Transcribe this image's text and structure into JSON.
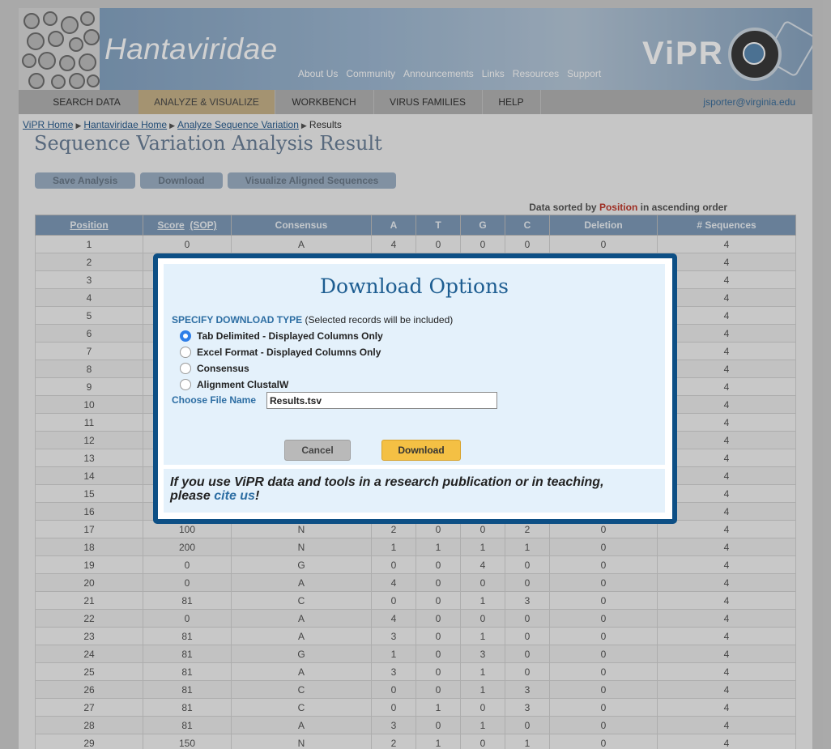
{
  "header": {
    "title": "Hantaviridae",
    "logo_text": "ViPR",
    "nav": [
      "About Us",
      "Community",
      "Announcements",
      "Links",
      "Resources",
      "Support"
    ]
  },
  "menu": {
    "items": [
      "SEARCH DATA",
      "ANALYZE & VISUALIZE",
      "WORKBENCH",
      "VIRUS FAMILIES",
      "HELP"
    ],
    "active": "ANALYZE & VISUALIZE",
    "user": "jsporter@virginia.edu"
  },
  "breadcrumb": {
    "links": [
      "ViPR Home",
      "Hantaviridae Home",
      "Analyze Sequence Variation"
    ],
    "current": "Results"
  },
  "page_title": "Sequence Variation Analysis Result",
  "action_buttons": [
    "Save Analysis",
    "Download",
    "Visualize Aligned Sequences"
  ],
  "sort_note": {
    "prefix": "Data sorted by",
    "field": "Position",
    "suffix": "in ascending order"
  },
  "table": {
    "columns": [
      "Position",
      "Score",
      "(SOP)",
      "Consensus",
      "A",
      "T",
      "G",
      "C",
      "Deletion",
      "# Sequences"
    ],
    "rows": [
      [
        "1",
        "0",
        "A",
        "4",
        "0",
        "0",
        "0",
        "0",
        "4"
      ],
      [
        "2",
        "",
        "",
        "",
        "",
        "",
        "",
        "",
        "4"
      ],
      [
        "3",
        "",
        "",
        "",
        "",
        "",
        "",
        "",
        "4"
      ],
      [
        "4",
        "",
        "",
        "",
        "",
        "",
        "",
        "",
        "4"
      ],
      [
        "5",
        "",
        "",
        "",
        "",
        "",
        "",
        "",
        "4"
      ],
      [
        "6",
        "",
        "",
        "",
        "",
        "",
        "",
        "",
        "4"
      ],
      [
        "7",
        "",
        "",
        "",
        "",
        "",
        "",
        "",
        "4"
      ],
      [
        "8",
        "",
        "",
        "",
        "",
        "",
        "",
        "",
        "4"
      ],
      [
        "9",
        "",
        "",
        "",
        "",
        "",
        "",
        "",
        "4"
      ],
      [
        "10",
        "",
        "",
        "",
        "",
        "",
        "",
        "",
        "4"
      ],
      [
        "11",
        "",
        "",
        "",
        "",
        "",
        "",
        "",
        "4"
      ],
      [
        "12",
        "",
        "",
        "",
        "",
        "",
        "",
        "",
        "4"
      ],
      [
        "13",
        "",
        "",
        "",
        "",
        "",
        "",
        "",
        "4"
      ],
      [
        "14",
        "",
        "",
        "",
        "",
        "",
        "",
        "",
        "4"
      ],
      [
        "15",
        "",
        "",
        "",
        "",
        "",
        "",
        "",
        "4"
      ],
      [
        "16",
        "",
        "",
        "",
        "",
        "",
        "",
        "",
        "4"
      ],
      [
        "17",
        "100",
        "N",
        "2",
        "0",
        "0",
        "2",
        "0",
        "4"
      ],
      [
        "18",
        "200",
        "N",
        "1",
        "1",
        "1",
        "1",
        "0",
        "4"
      ],
      [
        "19",
        "0",
        "G",
        "0",
        "0",
        "4",
        "0",
        "0",
        "4"
      ],
      [
        "20",
        "0",
        "A",
        "4",
        "0",
        "0",
        "0",
        "0",
        "4"
      ],
      [
        "21",
        "81",
        "C",
        "0",
        "0",
        "1",
        "3",
        "0",
        "4"
      ],
      [
        "22",
        "0",
        "A",
        "4",
        "0",
        "0",
        "0",
        "0",
        "4"
      ],
      [
        "23",
        "81",
        "A",
        "3",
        "0",
        "1",
        "0",
        "0",
        "4"
      ],
      [
        "24",
        "81",
        "G",
        "1",
        "0",
        "3",
        "0",
        "0",
        "4"
      ],
      [
        "25",
        "81",
        "A",
        "3",
        "0",
        "1",
        "0",
        "0",
        "4"
      ],
      [
        "26",
        "81",
        "C",
        "0",
        "0",
        "1",
        "3",
        "0",
        "4"
      ],
      [
        "27",
        "81",
        "C",
        "0",
        "1",
        "0",
        "3",
        "0",
        "4"
      ],
      [
        "28",
        "81",
        "A",
        "3",
        "0",
        "1",
        "0",
        "0",
        "4"
      ],
      [
        "29",
        "150",
        "N",
        "2",
        "1",
        "0",
        "1",
        "0",
        "4"
      ]
    ]
  },
  "dialog": {
    "title": "Download Options",
    "specify_label": "SPECIFY DOWNLOAD TYPE",
    "specify_note": "(Selected records will be included)",
    "options": [
      {
        "label": "Tab Delimited - Displayed Columns Only",
        "selected": true
      },
      {
        "label": "Excel Format - Displayed Columns Only",
        "selected": false
      },
      {
        "label": "Consensus",
        "selected": false
      },
      {
        "label": "Alignment ClustalW",
        "selected": false
      }
    ],
    "file_name_label": "Choose File Name",
    "file_name_value": "Results.tsv",
    "cancel_label": "Cancel",
    "download_label": "Download",
    "cite_line1": "If you use ViPR data and tools in a research publication or in teaching,",
    "cite_prefix": "please",
    "cite_link": "cite us",
    "cite_suffix": "!"
  },
  "colors": {
    "modal_border": "#0d4f85",
    "modal_body": "#e4f1fb",
    "download_button": "#f4c044",
    "table_header": "#7f9cba"
  }
}
